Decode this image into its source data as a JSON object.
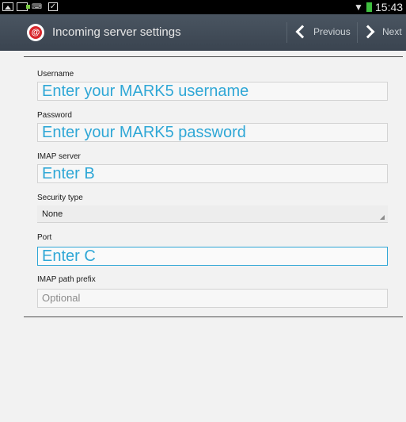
{
  "status_bar": {
    "time": "15:43",
    "icons": [
      "image-icon",
      "usb-icon",
      "keyboard-icon",
      "checkbox-icon",
      "wifi-icon",
      "battery-icon"
    ]
  },
  "action_bar": {
    "title": "Incoming server settings",
    "app_icon": "email-app-icon",
    "previous_label": "Previous",
    "next_label": "Next"
  },
  "form": {
    "username_label": "Username",
    "username_value": "Enter your MARK5 username",
    "password_label": "Password",
    "password_value": "Enter your MARK5 password",
    "imap_server_label": "IMAP server",
    "imap_server_value": "Enter B",
    "security_type_label": "Security type",
    "security_type_value": "None",
    "port_label": "Port",
    "port_value": "Enter C",
    "imap_path_prefix_label": "IMAP path prefix",
    "imap_path_prefix_placeholder": "Optional"
  },
  "colors": {
    "accent": "#2fa7d6",
    "action_bar": "#3f4a56",
    "app_icon_red": "#d8262b",
    "battery": "#3fbf3f"
  }
}
